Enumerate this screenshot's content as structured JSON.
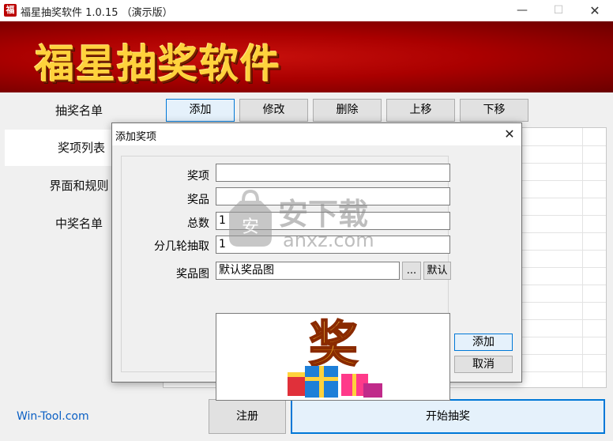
{
  "window": {
    "title": "福星抽奖软件 1.0.15  （演示版）",
    "icon_char": "福",
    "minimize": "—",
    "maximize": "☐",
    "close": "✕"
  },
  "banner": {
    "title": "福星抽奖软件"
  },
  "sidebar": {
    "items": [
      {
        "label": "抽奖名单"
      },
      {
        "label": "奖项列表"
      },
      {
        "label": "界面和规则"
      },
      {
        "label": "中奖名单"
      }
    ]
  },
  "toolbar": {
    "add": "添加",
    "edit": "修改",
    "delete": "删除",
    "move_up": "上移",
    "move_down": "下移"
  },
  "bottom": {
    "link": "Win-Tool.com",
    "register": "注册",
    "start": "开始抽奖"
  },
  "dialog": {
    "title": "添加奖项",
    "close": "✕",
    "fields": {
      "award_label": "奖项",
      "award_value": "",
      "prize_label": "奖品",
      "prize_value": "",
      "total_label": "总数",
      "total_value": "1",
      "rounds_label": "分几轮抽取",
      "rounds_value": "1",
      "image_label": "奖品图",
      "image_value": "默认奖品图"
    },
    "browse": "...",
    "default": "默认",
    "image_char": "奖",
    "add": "添加",
    "cancel": "取消"
  },
  "watermark": {
    "text": "安下载",
    "sub": "anxz.com"
  },
  "colors": {
    "accent": "#0078d7",
    "banner_red": "#a00000",
    "banner_gold": "#ffd23c",
    "link": "#0a5fc4"
  }
}
